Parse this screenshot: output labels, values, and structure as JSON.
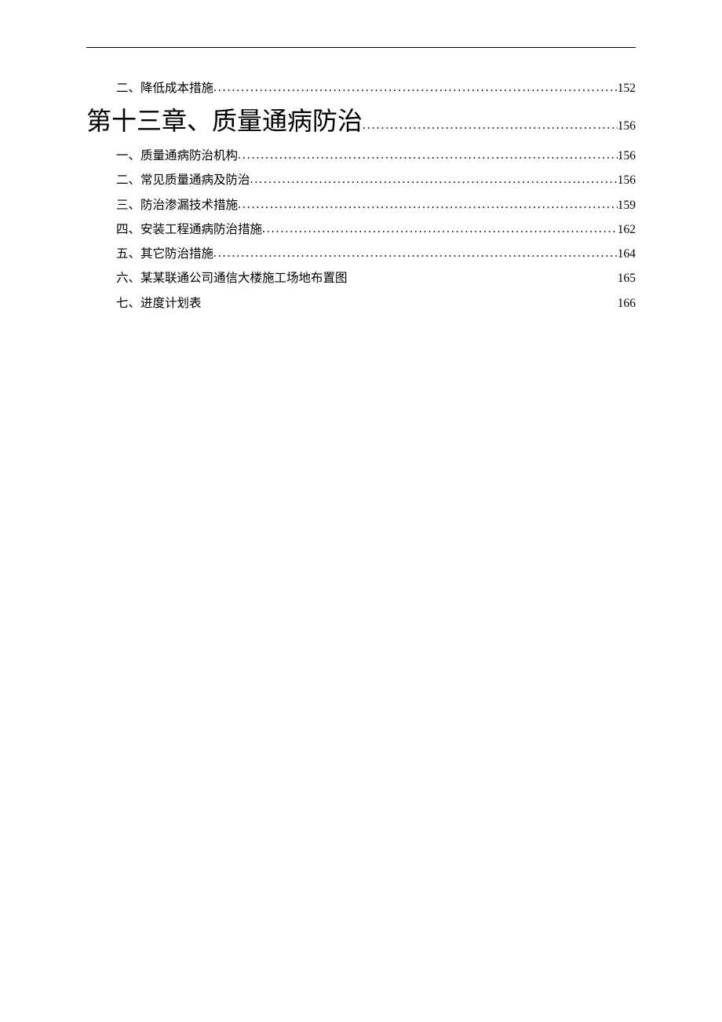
{
  "toc": {
    "entries": [
      {
        "level": "sub",
        "title": "二、降低成本措施",
        "page": "152",
        "dots": true
      },
      {
        "level": "chapter",
        "title": "第十三章、质量通病防治",
        "page": "156",
        "dots": true
      },
      {
        "level": "sub",
        "title": "一、质量通病防治机构",
        "page": "156",
        "dots": true
      },
      {
        "level": "sub",
        "title": "二、常见质量通病及防治",
        "page": "156",
        "dots": true
      },
      {
        "level": "sub",
        "title": "三、防治渗漏技术措施",
        "page": "159",
        "dots": true
      },
      {
        "level": "sub",
        "title": "四、安装工程通病防治措施",
        "page": "162",
        "dots": true
      },
      {
        "level": "sub",
        "title": "五、其它防治措施",
        "page": "164",
        "dots": true
      },
      {
        "level": "sub",
        "title": "六、某某联通公司通信大楼施工场地布置图",
        "page": "165",
        "dots": false
      },
      {
        "level": "sub",
        "title": "七、进度计划表",
        "page": "166",
        "dots": false
      }
    ]
  }
}
